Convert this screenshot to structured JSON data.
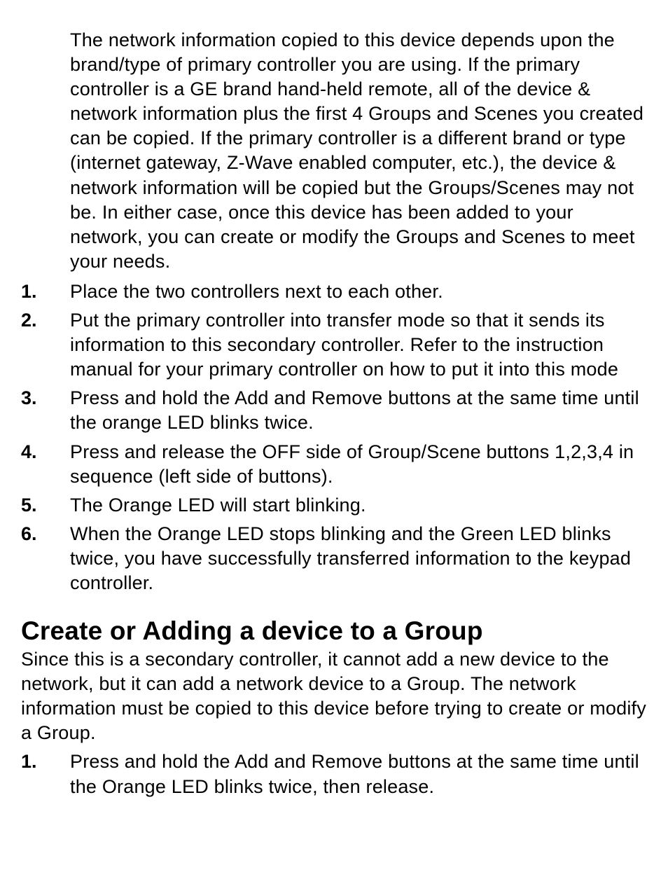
{
  "intro": "The network information copied to this device depends upon the brand/type of primary controller you are using.  If the primary controller is a GE brand hand-held remote, all of the device & network information plus the first 4 Groups and Scenes you created can be copied.  If the primary controller is a different brand or type (internet gateway, Z-Wave enabled computer, etc.), the device & network information will be copied but the Groups/Scenes may not be.  In either case, once this device has been added to your network, you can create or modify the Groups and Scenes to meet your needs.",
  "transferSteps": [
    "Place the two controllers next to each other.",
    "Put the primary controller into transfer mode so that it sends its information to this secondary controller. Refer to the instruction manual for your primary controller on how to put it into this mode",
    "Press and hold the Add and Remove buttons at the same time until the orange LED blinks twice.",
    "Press and release the OFF side of Group/Scene buttons 1,2,3,4 in sequence (left side of buttons).",
    "The Orange LED will start blinking.",
    "When the Orange LED stops blinking and the Green LED blinks twice, you have successfully transferred information to the keypad controller."
  ],
  "groupSection": {
    "heading": "Create or Adding a device to a Group",
    "intro": "Since this is a secondary controller, it cannot add a new device to the network, but it can add a network device to a Group.  The network information must be copied to this device before trying to create or modify a Group.",
    "steps": [
      "Press and hold the Add and Remove buttons at the same time until the Orange LED blinks twice, then release."
    ]
  }
}
